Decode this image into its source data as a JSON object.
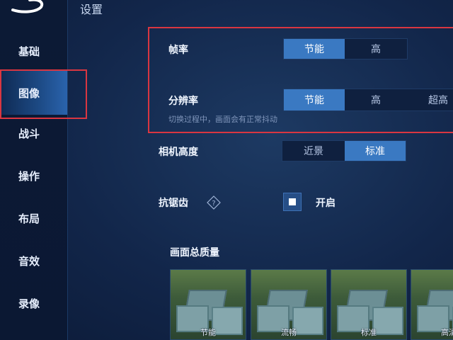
{
  "title": "设置",
  "sidebar": {
    "items": [
      {
        "label": "基础"
      },
      {
        "label": "图像"
      },
      {
        "label": "战斗"
      },
      {
        "label": "操作"
      },
      {
        "label": "布局"
      },
      {
        "label": "音效"
      },
      {
        "label": "录像"
      }
    ],
    "active": "图像"
  },
  "settings": {
    "frame_rate": {
      "label": "帧率",
      "options": [
        "节能",
        "高"
      ],
      "selected": "节能"
    },
    "resolution": {
      "label": "分辨率",
      "options": [
        "节能",
        "高",
        "超高"
      ],
      "selected": "节能"
    },
    "resolution_hint": "切换过程中，画面会有正常抖动",
    "camera_height": {
      "label": "相机高度",
      "options": [
        "近景",
        "标准"
      ],
      "selected": "标准"
    },
    "anti_aliasing": {
      "label": "抗锯齿",
      "toggle_label": "开启",
      "enabled": true
    },
    "overall_quality": {
      "label": "画面总质量",
      "thumbnails": [
        "节能",
        "流畅",
        "标准",
        "高清"
      ]
    }
  },
  "colors": {
    "accent": "#3a79c2",
    "highlight_outline": "#d93641"
  }
}
